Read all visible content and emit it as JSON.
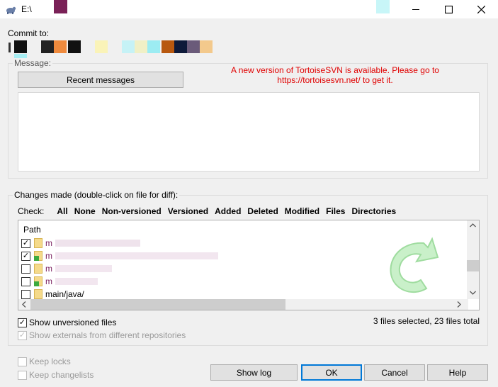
{
  "window": {
    "title": "E:\\",
    "minimize_icon": "minimize-icon",
    "maximize_icon": "maximize-icon",
    "close_icon": "close-icon"
  },
  "commit_to": {
    "label": "Commit to:"
  },
  "message": {
    "group_label": "Message:",
    "recent_button": "Recent messages",
    "notice_line1": "A new version of TortoiseSVN is available. Please go to",
    "notice_line2": "https://tortoisesvn.net/ to get it.",
    "value": ""
  },
  "changes": {
    "group_label": "Changes made (double-click on file for diff):",
    "check_label": "Check:",
    "check_options": [
      "All",
      "None",
      "Non-versioned",
      "Versioned",
      "Added",
      "Deleted",
      "Modified",
      "Files",
      "Directories"
    ],
    "column_path": "Path",
    "rows": [
      {
        "checked": true,
        "modified": false,
        "text": "m"
      },
      {
        "checked": true,
        "modified": true,
        "text": "m"
      },
      {
        "checked": false,
        "modified": false,
        "text": "m"
      },
      {
        "checked": false,
        "modified": true,
        "text": "m"
      },
      {
        "checked": false,
        "modified": false,
        "text": "main/java/"
      }
    ],
    "show_unversioned": "Show unversioned files",
    "show_externals": "Show externals from different repositories",
    "summary": "3 files selected, 23 files total"
  },
  "bottom": {
    "keep_locks": "Keep locks",
    "keep_changelists": "Keep changelists",
    "show_log": "Show log",
    "ok": "OK",
    "cancel": "Cancel",
    "help": "Help"
  },
  "colors": {
    "accent": "#0078d7",
    "notice": "#e00000"
  }
}
